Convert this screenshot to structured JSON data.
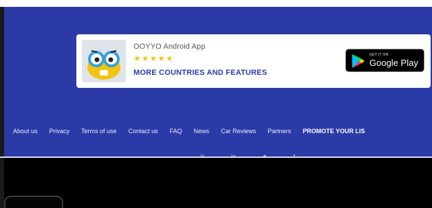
{
  "banner": {
    "title": "OOYYO Android App",
    "stars": "★★★★★",
    "subtitle": "MORE COUNTRIES AND FEATURES",
    "store_small": "GET IT ON",
    "store_name": "Google Play"
  },
  "nav": {
    "items": [
      "About us",
      "Privacy",
      "Terms of use",
      "Contact us",
      "FAQ",
      "News",
      "Car Reviews",
      "Partners",
      "PROMOTE YOUR LIS"
    ]
  },
  "social_icons": [
    "instagram-icon",
    "linkedin-icon",
    "twitter-icon",
    "facebook-icon"
  ],
  "colors": {
    "footer_blue": "#2b3aa6",
    "star_yellow": "#f3c419",
    "banner_bg": "#ffffff"
  }
}
